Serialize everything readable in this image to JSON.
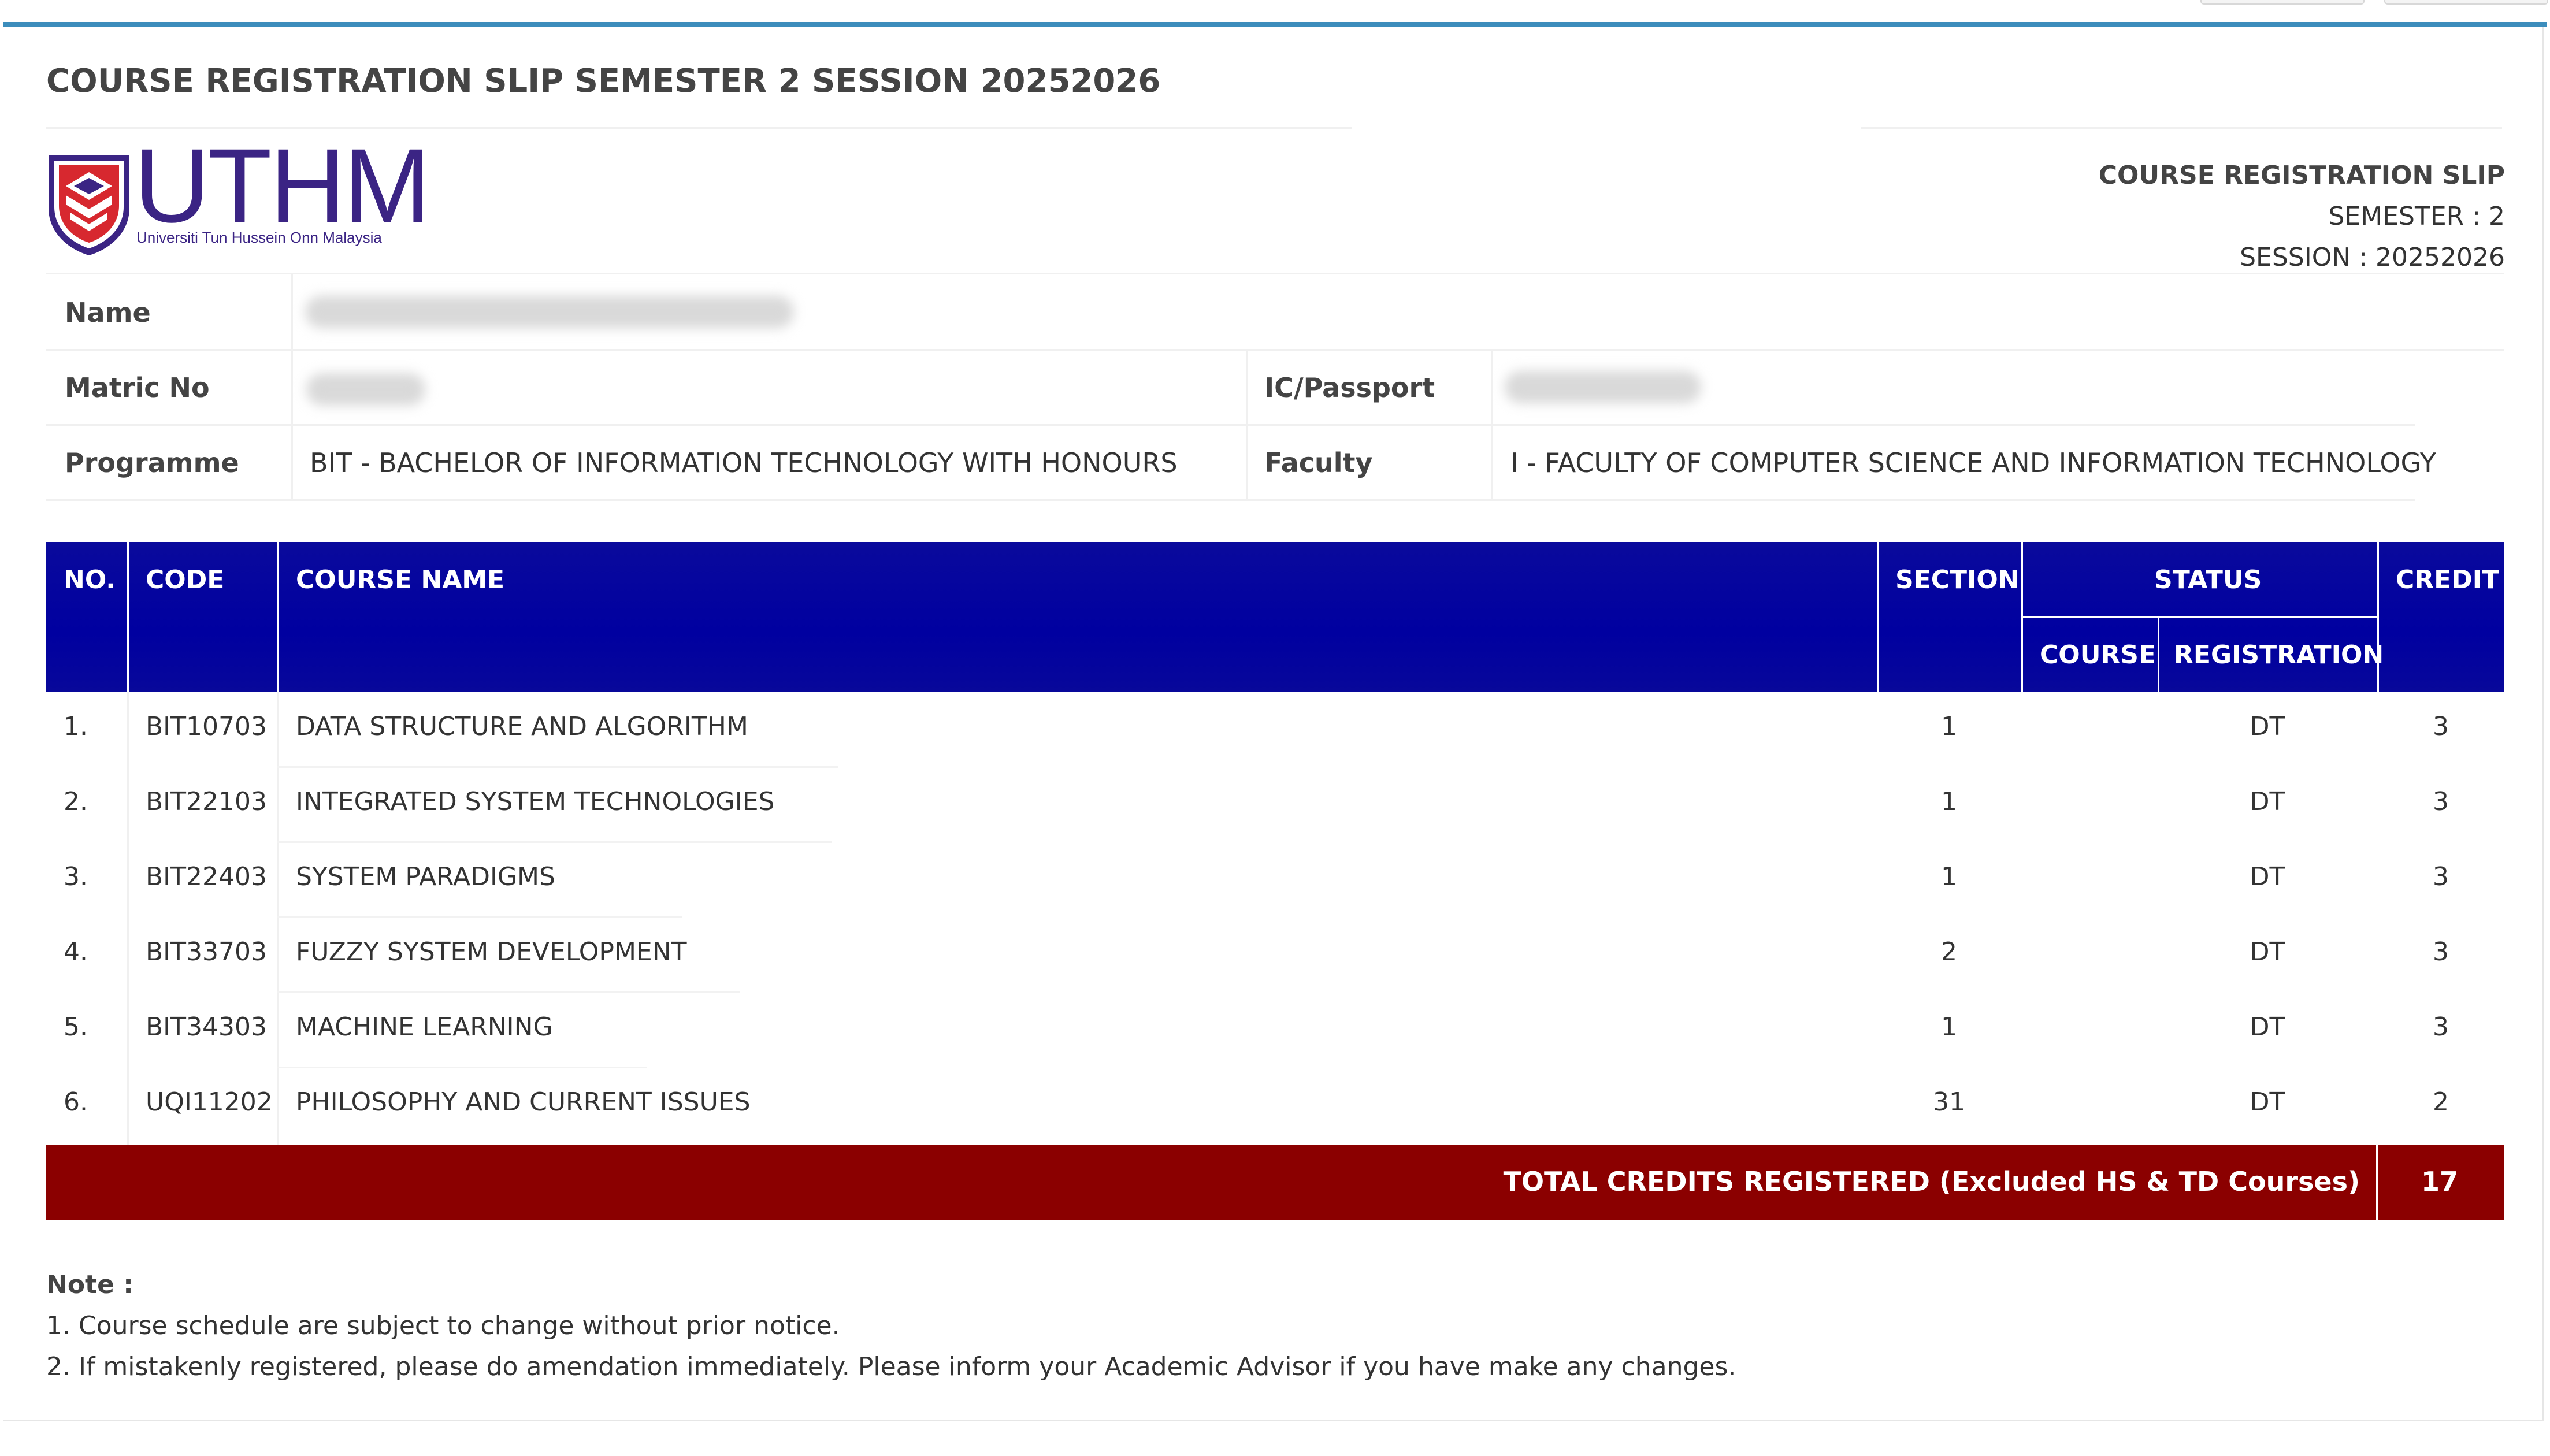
{
  "page": {
    "title": "COURSE REGISTRATION SLIP SEMESTER 2 SESSION 20252026"
  },
  "logo": {
    "wordmark": "UTHM",
    "tagline": "Universiti Tun Hussein Onn Malaysia",
    "colors": {
      "primary": "#3b2484",
      "shield_red": "#d7282f",
      "shield_blue": "#3b2484"
    }
  },
  "slip_header": {
    "title": "COURSE REGISTRATION SLIP",
    "semester": "SEMESTER : 2",
    "session": "SESSION : 20252026"
  },
  "student": {
    "name_label": "Name",
    "matric_label": "Matric No",
    "ic_label": "IC/Passport",
    "programme_label": "Programme",
    "programme_value": "BIT - BACHELOR OF INFORMATION TECHNOLOGY WITH HONOURS",
    "faculty_label": "Faculty",
    "faculty_value": "I - FACULTY OF COMPUTER SCIENCE AND INFORMATION TECHNOLOGY"
  },
  "table": {
    "headers": {
      "no": "NO.",
      "code": "CODE",
      "course_name": "COURSE NAME",
      "section": "SECTION",
      "status": "STATUS",
      "status_course": "COURSE",
      "status_registration": "REGISTRATION",
      "credit": "CREDIT"
    },
    "rows": [
      {
        "no": "1.",
        "code": "BIT10703",
        "name": "DATA STRUCTURE AND ALGORITHM",
        "section": "1",
        "course_status": "",
        "registration": "DT",
        "credit": "3"
      },
      {
        "no": "2.",
        "code": "BIT22103",
        "name": "INTEGRATED SYSTEM TECHNOLOGIES",
        "section": "1",
        "course_status": "",
        "registration": "DT",
        "credit": "3"
      },
      {
        "no": "3.",
        "code": "BIT22403",
        "name": "SYSTEM PARADIGMS",
        "section": "1",
        "course_status": "",
        "registration": "DT",
        "credit": "3"
      },
      {
        "no": "4.",
        "code": "BIT33703",
        "name": "FUZZY SYSTEM DEVELOPMENT",
        "section": "2",
        "course_status": "",
        "registration": "DT",
        "credit": "3"
      },
      {
        "no": "5.",
        "code": "BIT34303",
        "name": "MACHINE LEARNING",
        "section": "1",
        "course_status": "",
        "registration": "DT",
        "credit": "3"
      },
      {
        "no": "6.",
        "code": "UQI11202",
        "name": "PHILOSOPHY AND CURRENT ISSUES",
        "section": "31",
        "course_status": "",
        "registration": "DT",
        "credit": "2"
      }
    ],
    "total_label": "TOTAL CREDITS REGISTERED (Excluded HS & TD Courses)",
    "total_value": "17",
    "colors": {
      "header_bg": "#0000a0",
      "total_bg": "#8b0000"
    }
  },
  "notes": {
    "title": "Note :",
    "items": [
      "1. Course schedule are subject to change without prior notice.",
      "2. If mistakenly registered, please do amendation immediately. Please inform your Academic Advisor if you have make any changes."
    ]
  }
}
